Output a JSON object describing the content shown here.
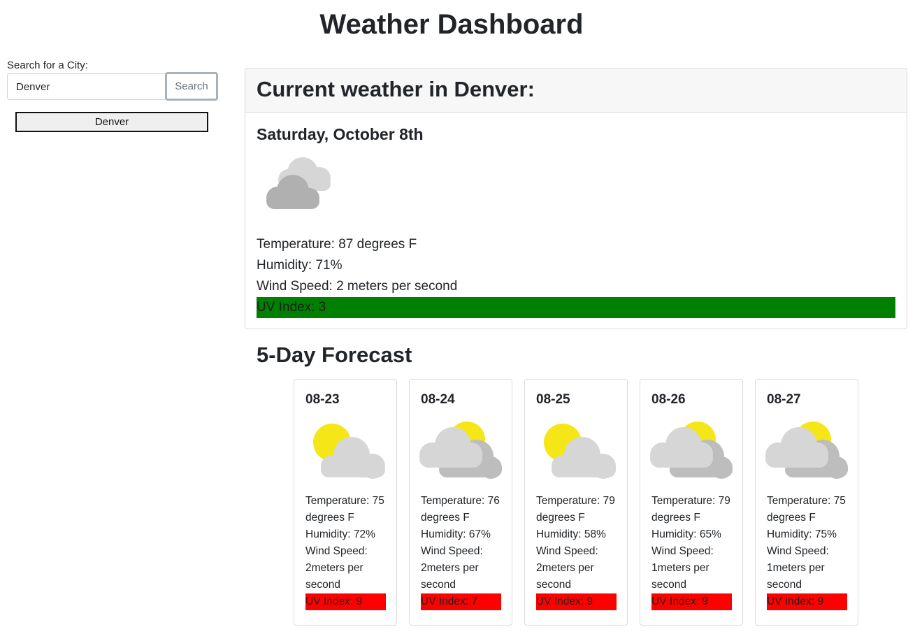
{
  "header": {
    "title": "Weather Dashboard"
  },
  "sidebar": {
    "search_label": "Search for a City:",
    "search_value": "Denver",
    "search_button": "Search",
    "history": [
      "Denver"
    ]
  },
  "current": {
    "heading": "Current weather in Denver:",
    "date": "Saturday, October 8th",
    "icon": "clouds-icon",
    "temperature": "Temperature: 87 degrees F",
    "humidity": "Humidity: 71%",
    "wind": "Wind Speed: 2 meters per second",
    "uv": "UV Index: 3",
    "uv_color": "#008000"
  },
  "forecast": {
    "title": "5-Day Forecast",
    "days": [
      {
        "date": "08-23",
        "icon": "sun-behind-cloud-icon",
        "temp": "Temperature: 75 degrees F",
        "humidity": "Humidity: 72%",
        "wind": "Wind Speed: 2meters per second",
        "uv": "UV Index: 9"
      },
      {
        "date": "08-24",
        "icon": "partly-cloudy-icon",
        "temp": "Temperature: 76 degrees F",
        "humidity": "Humidity: 67%",
        "wind": "Wind Speed: 2meters per second",
        "uv": "UV Index: 7"
      },
      {
        "date": "08-25",
        "icon": "sun-behind-cloud-icon",
        "temp": "Temperature: 79 degrees F",
        "humidity": "Humidity: 58%",
        "wind": "Wind Speed: 2meters per second",
        "uv": "UV Index: 9"
      },
      {
        "date": "08-26",
        "icon": "partly-cloudy-icon",
        "temp": "Temperature: 79 degrees F",
        "humidity": "Humidity: 65%",
        "wind": "Wind Speed: 1meters per second",
        "uv": "UV Index: 9"
      },
      {
        "date": "08-27",
        "icon": "partly-cloudy-icon",
        "temp": "Temperature: 75 degrees F",
        "humidity": "Humidity: 75%",
        "wind": "Wind Speed: 1meters per second",
        "uv": "UV Index: 9"
      }
    ],
    "uv_color": "#ff0000"
  }
}
